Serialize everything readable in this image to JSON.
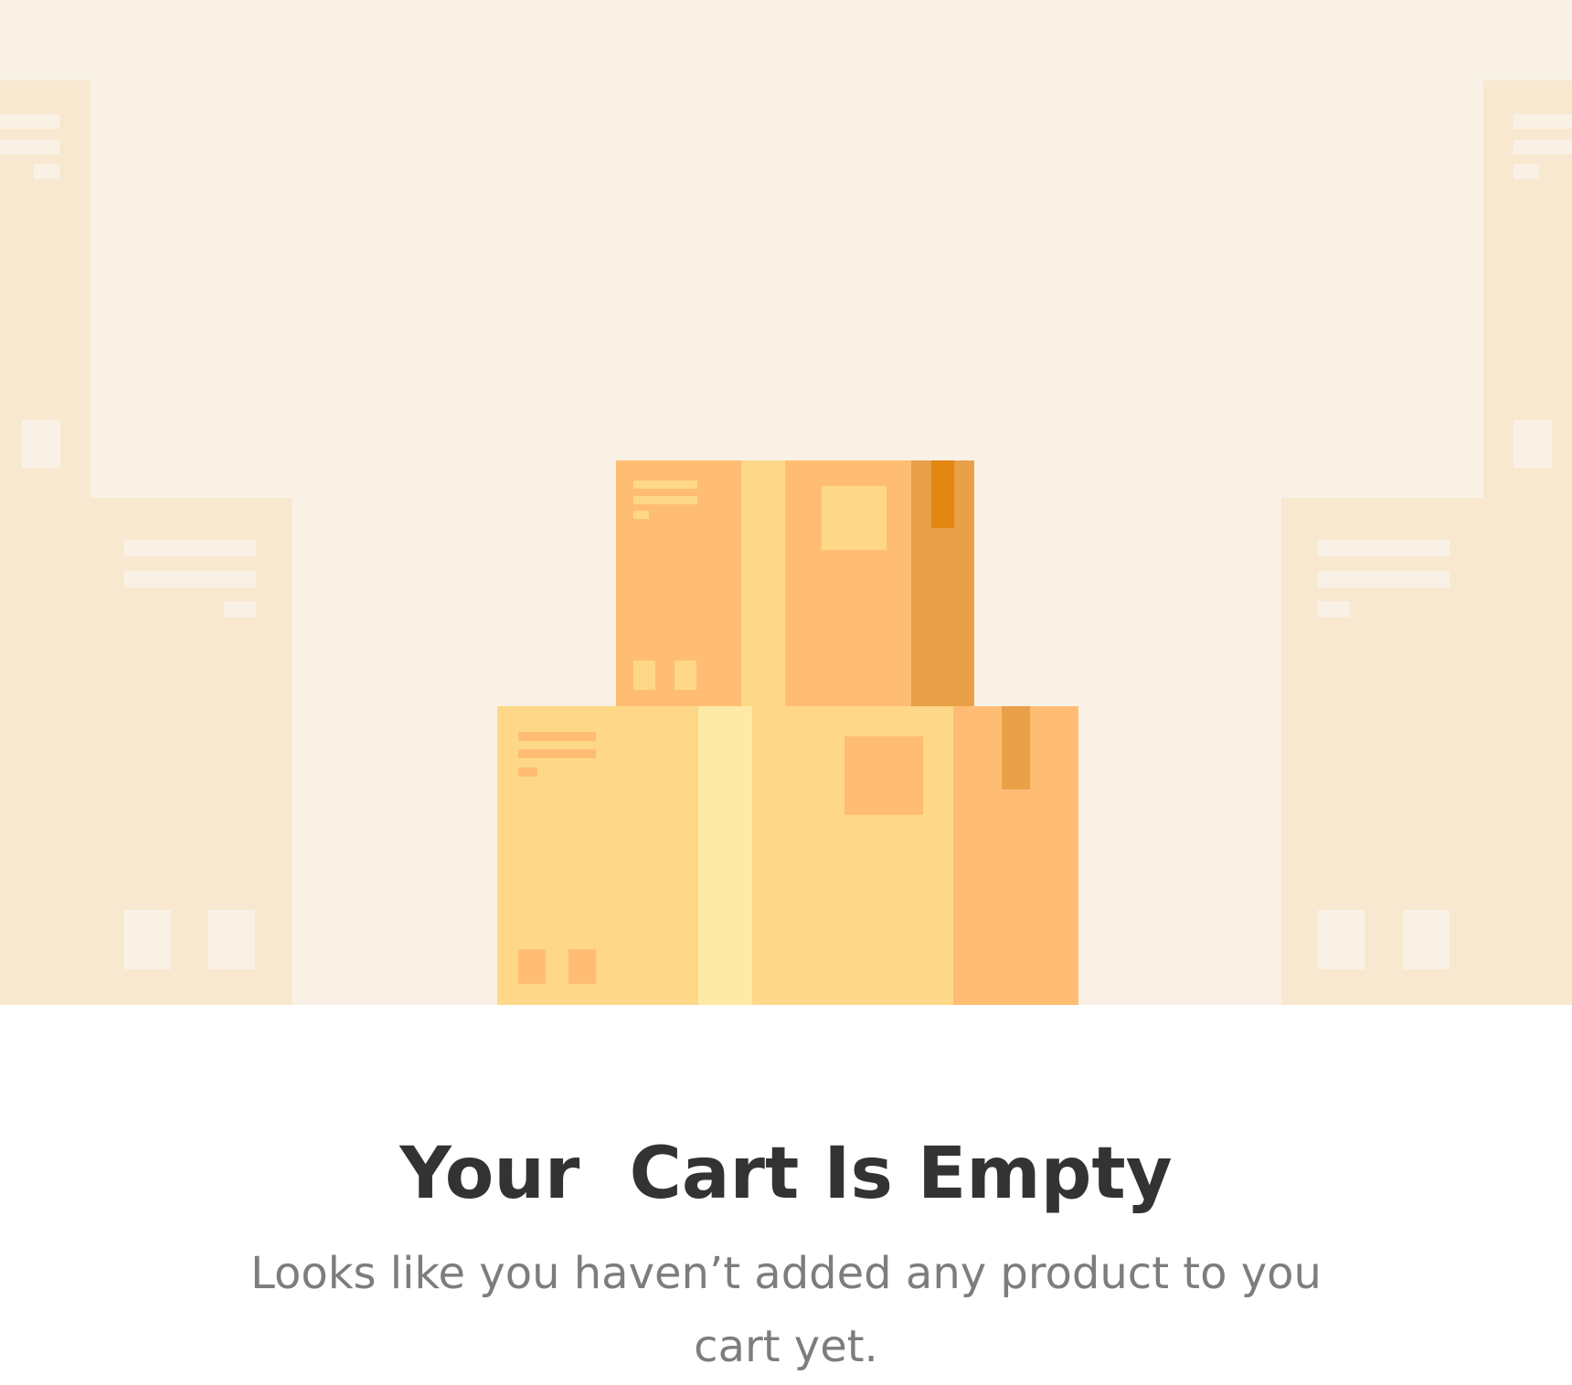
{
  "empty_cart": {
    "title": "Your  Cart Is Empty",
    "message": "Looks like you haven’t added any product to you cart yet."
  },
  "illustration": {
    "icon": "empty-boxes-illustration",
    "colors": {
      "background": "#f9f1e5",
      "building": "#f9e8d0",
      "building_detail": "#f9f1e5",
      "box_light": "#fed888",
      "box_orange": "#ffbd73",
      "box_dark": "#e9a048",
      "tape_light": "#feeaa6",
      "tape_dark": "#e28712"
    }
  }
}
